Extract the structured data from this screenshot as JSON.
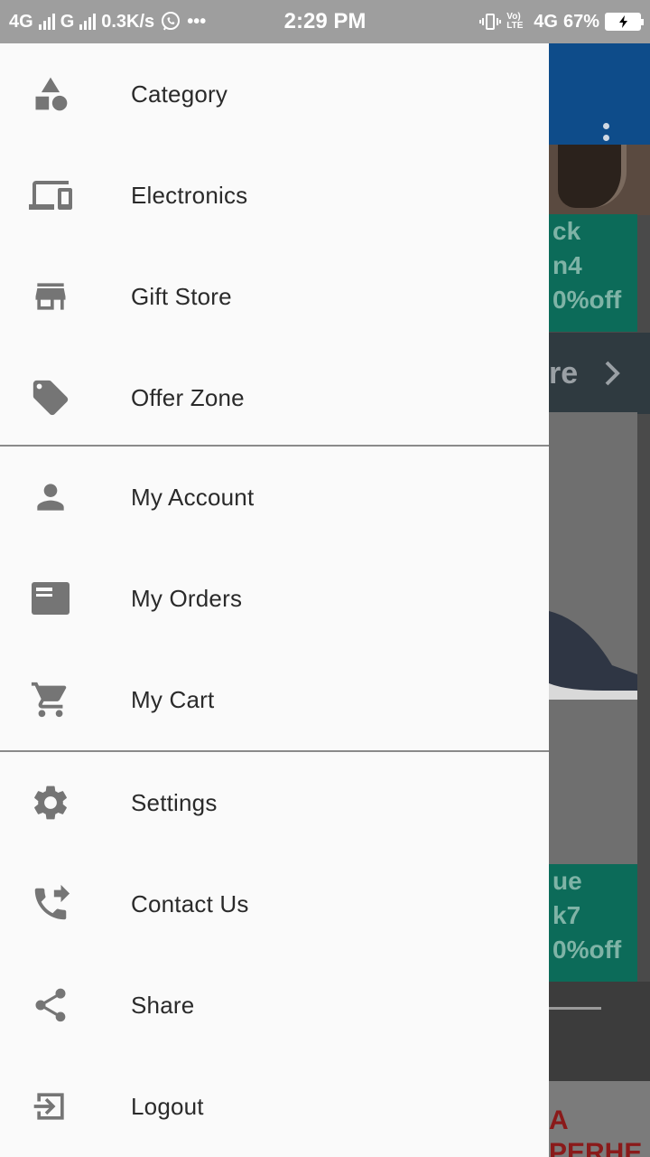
{
  "status_bar": {
    "net1": "4G",
    "net2": "G",
    "speed": "0.3K/s",
    "more": "•••",
    "time": "2:29 PM",
    "volte": "Vo) LTE",
    "net3": "4G",
    "battery": "67%"
  },
  "background": {
    "green1_lines": [
      "ck",
      "n4",
      "0%off"
    ],
    "strip_text": "re",
    "green2_lines": [
      "ue",
      "k7",
      "0%off"
    ],
    "ad_lines": [
      "A",
      "PERHE"
    ]
  },
  "drawer": {
    "items": [
      {
        "label": "Category",
        "icon": "category-icon"
      },
      {
        "label": "Electronics",
        "icon": "devices-icon"
      },
      {
        "label": "Gift Store",
        "icon": "store-icon"
      },
      {
        "label": "Offer Zone",
        "icon": "tag-icon"
      },
      {
        "label": "My Account",
        "icon": "person-icon"
      },
      {
        "label": "My Orders",
        "icon": "orders-icon"
      },
      {
        "label": "My Cart",
        "icon": "cart-icon"
      },
      {
        "label": "Settings",
        "icon": "gear-icon"
      },
      {
        "label": "Contact Us",
        "icon": "phone-forwarded-icon"
      },
      {
        "label": "Share",
        "icon": "share-icon"
      },
      {
        "label": "Logout",
        "icon": "logout-icon"
      }
    ]
  },
  "colors": {
    "drawer_bg": "#fafafa",
    "icon": "#757575",
    "text": "#2a2a2a",
    "status_bar": "#9e9e9e",
    "app_bar": "#0e4c8a",
    "promo_green": "#0c6b59"
  }
}
